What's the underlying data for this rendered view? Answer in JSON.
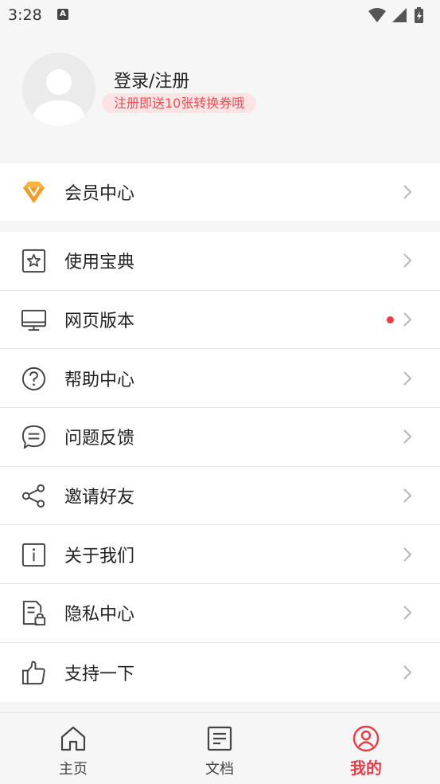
{
  "status_bar": {
    "time": "3:28",
    "notification_letter": "A"
  },
  "profile": {
    "login_label": "登录/注册",
    "promo_badge": "注册即送10张转换券哦"
  },
  "vip": {
    "label": "会员中心",
    "icon": "diamond-v-icon"
  },
  "menu": [
    {
      "label": "使用宝典",
      "icon": "star-box-icon"
    },
    {
      "label": "网页版本",
      "icon": "monitor-icon",
      "has_dot": true
    },
    {
      "label": "帮助中心",
      "icon": "question-circle-icon"
    },
    {
      "label": "问题反馈",
      "icon": "chat-bubble-icon"
    },
    {
      "label": "邀请好友",
      "icon": "share-icon"
    },
    {
      "label": "关于我们",
      "icon": "info-box-icon"
    },
    {
      "label": "隐私中心",
      "icon": "doc-lock-icon"
    },
    {
      "label": "支持一下",
      "icon": "thumbs-up-icon"
    }
  ],
  "tabs": [
    {
      "label": "主页",
      "icon": "home-icon",
      "active": false
    },
    {
      "label": "文档",
      "icon": "document-icon",
      "active": false
    },
    {
      "label": "我的",
      "icon": "user-circle-icon",
      "active": true
    }
  ],
  "colors": {
    "accent": "#ee3b46",
    "badge_bg": "#fde4e4",
    "badge_text": "#ee4e54",
    "vip_gold": "#f6b340",
    "icon": "#444444"
  }
}
